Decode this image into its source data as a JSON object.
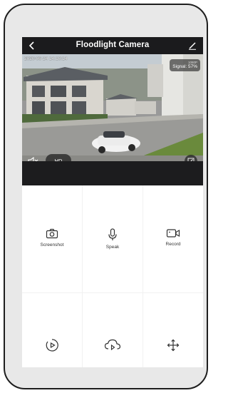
{
  "header": {
    "title": "Floodlight Camera",
    "back_icon": "chevron-left-icon",
    "edit_icon": "pencil-icon"
  },
  "video": {
    "timestamp": "2020-06-24 14:10:14",
    "resolution": "1080P",
    "signal": "Signal: 57%",
    "quality_label": "HD",
    "mute_icon": "speaker-muted-icon",
    "fullscreen_icon": "expand-icon"
  },
  "controls": {
    "screenshot_label": "Screenshot",
    "speak_label": "Speak",
    "record_label": "Record",
    "playback_icon": "playback-icon",
    "cloud_icon": "cloud-playback-icon",
    "ptz_icon": "move-arrows-icon"
  },
  "colors": {
    "header_bg": "#1b1b1d",
    "band_bg": "#1c1c1e",
    "icon_color": "#333333",
    "frame_bg": "#e8e8e8"
  }
}
